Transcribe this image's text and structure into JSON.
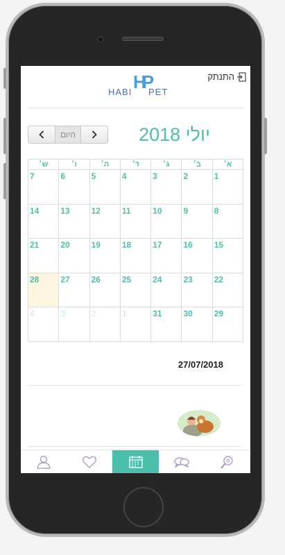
{
  "header": {
    "logout_label": "התנתק",
    "logo_text_left": "HABI",
    "logo_text_right": "PET",
    "logo_monogram": "HP"
  },
  "calendar": {
    "month_title": "יולי 2018",
    "today_button": "היום",
    "prev_icon": "chevron-left-icon",
    "next_icon": "chevron-right-icon",
    "weekdays": [
      "א׳",
      "ב׳",
      "ג׳",
      "ד׳",
      "ה׳",
      "ו׳",
      "ש׳"
    ],
    "weeks": [
      [
        {
          "d": "1"
        },
        {
          "d": "2"
        },
        {
          "d": "3"
        },
        {
          "d": "4"
        },
        {
          "d": "5"
        },
        {
          "d": "6"
        },
        {
          "d": "7"
        }
      ],
      [
        {
          "d": "8"
        },
        {
          "d": "9"
        },
        {
          "d": "10"
        },
        {
          "d": "11"
        },
        {
          "d": "12"
        },
        {
          "d": "13"
        },
        {
          "d": "14"
        }
      ],
      [
        {
          "d": "15"
        },
        {
          "d": "16"
        },
        {
          "d": "17"
        },
        {
          "d": "18"
        },
        {
          "d": "19"
        },
        {
          "d": "20"
        },
        {
          "d": "21"
        }
      ],
      [
        {
          "d": "22"
        },
        {
          "d": "23"
        },
        {
          "d": "24"
        },
        {
          "d": "25"
        },
        {
          "d": "26"
        },
        {
          "d": "27"
        },
        {
          "d": "28",
          "today": true
        }
      ],
      [
        {
          "d": "29"
        },
        {
          "d": "30"
        },
        {
          "d": "31"
        },
        {
          "d": "1",
          "other": true
        },
        {
          "d": "2",
          "other": true
        },
        {
          "d": "3",
          "other": true
        },
        {
          "d": "4",
          "other": true
        }
      ]
    ]
  },
  "selected_date": "27/07/2018",
  "tabbar": {
    "items": [
      {
        "icon": "user-icon"
      },
      {
        "icon": "heart-icon"
      },
      {
        "icon": "calendar-icon",
        "active": true
      },
      {
        "icon": "chat-icon"
      },
      {
        "icon": "search-pet-icon"
      }
    ]
  },
  "colors": {
    "accent": "#4cbfac",
    "today_bg": "#fcf6e0",
    "logo_blue": "#4a6fb5"
  }
}
